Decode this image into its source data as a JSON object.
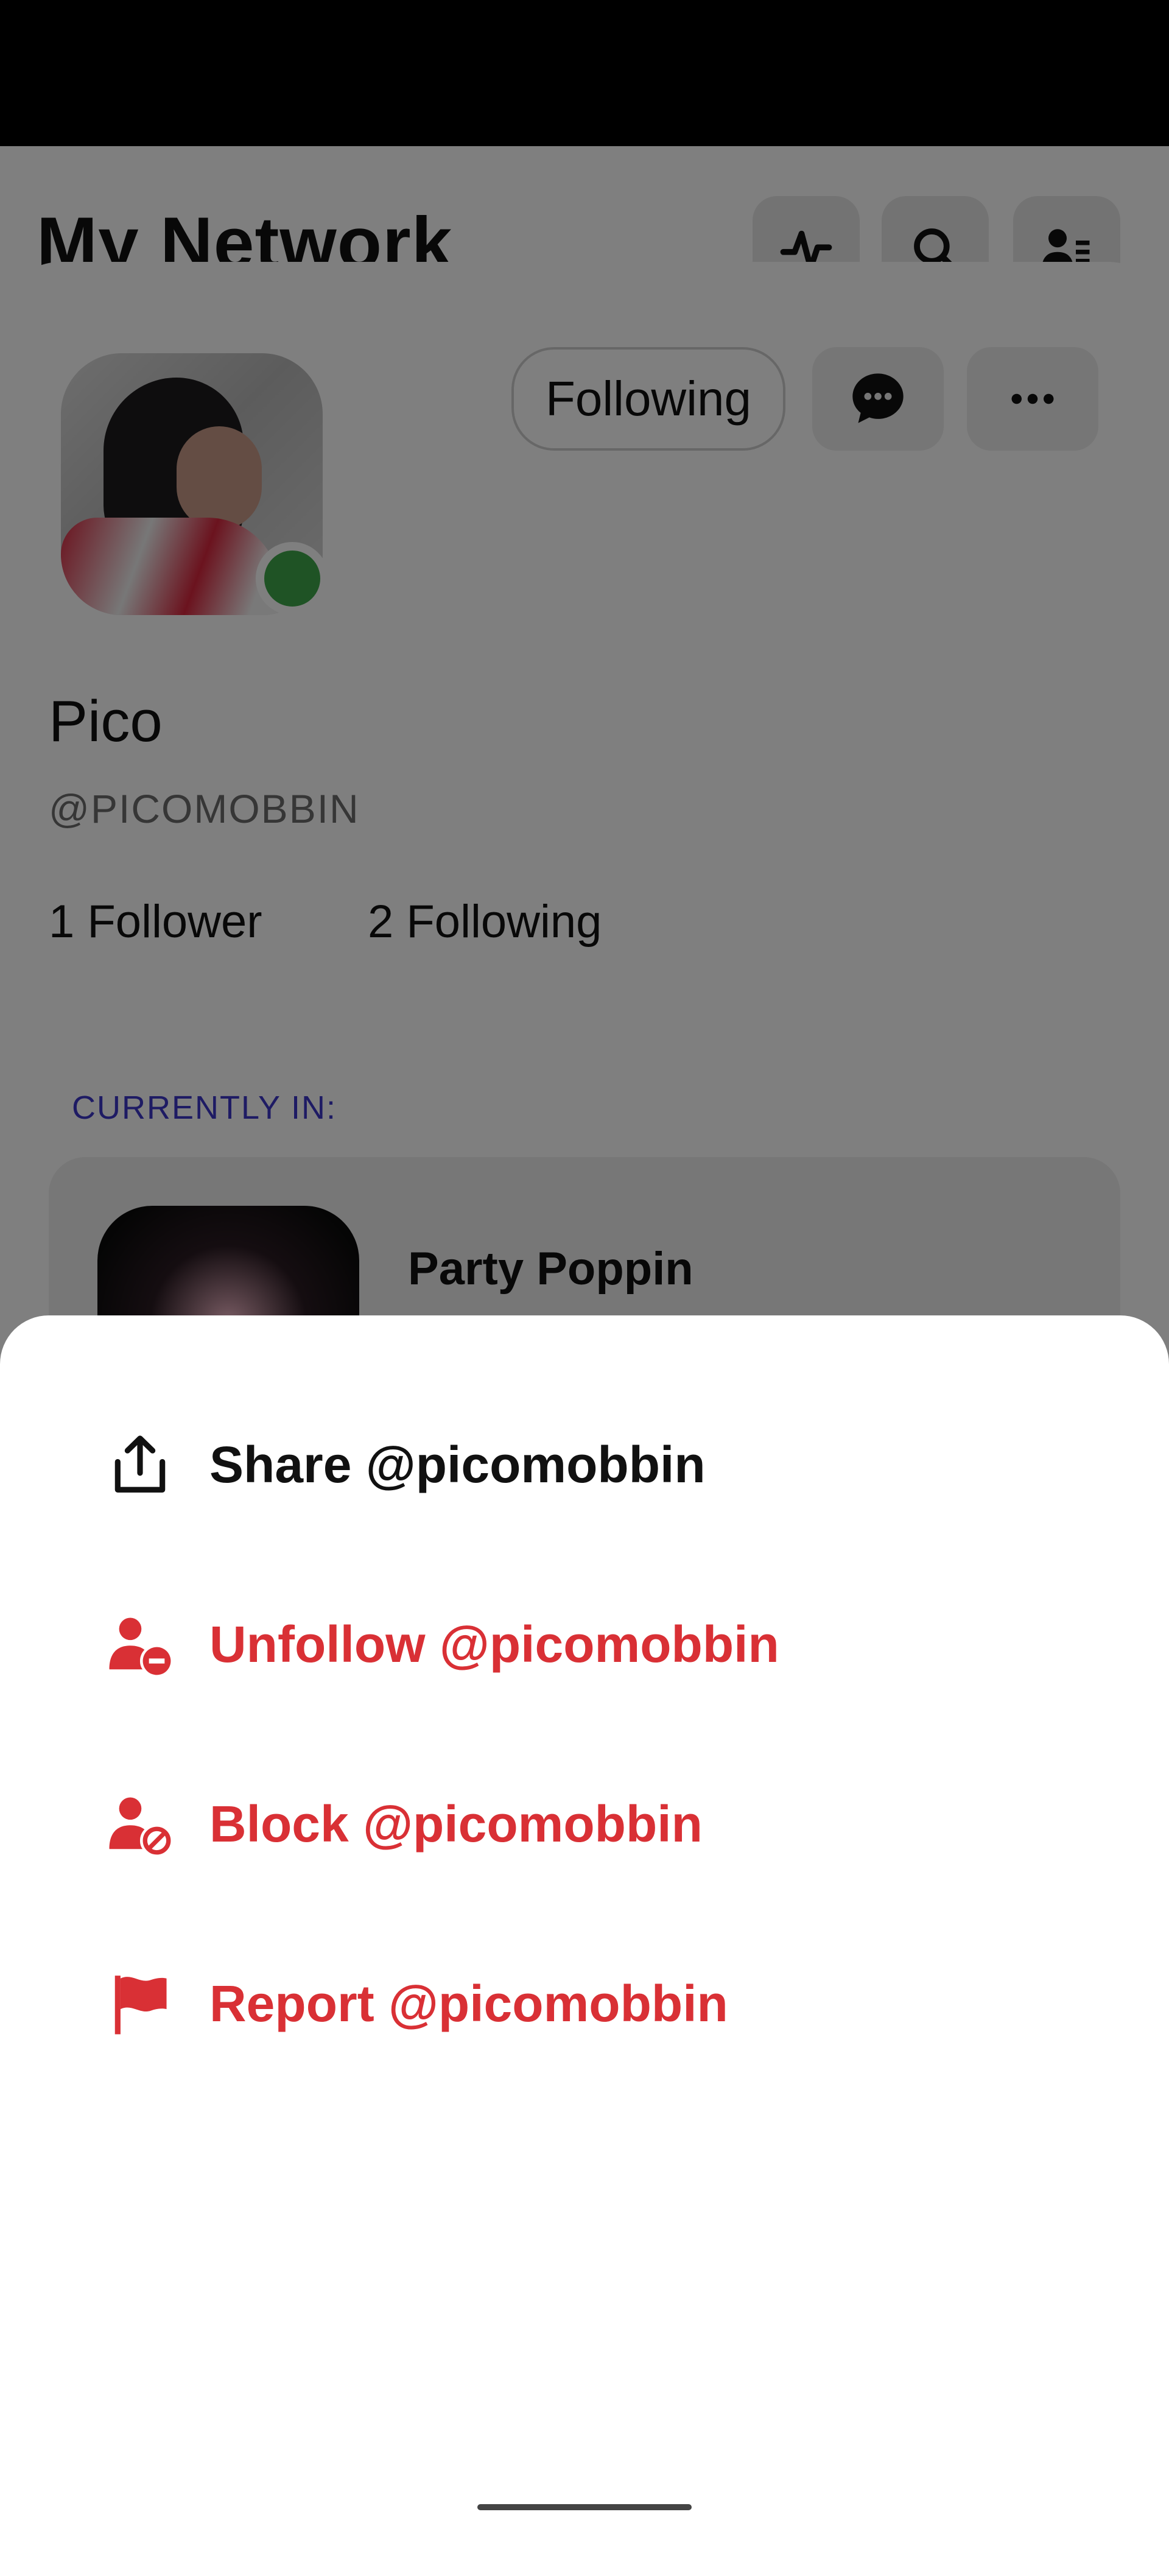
{
  "background": {
    "page_title": "My Network",
    "header_icons": [
      "activity-icon",
      "search-icon",
      "contacts-icon"
    ],
    "profile": {
      "following_button": "Following",
      "name": "Pico",
      "handle": "@PICOMOBBIN",
      "followers": "1 Follower",
      "following": "2 Following",
      "currently_in_label": "CURRENTLY IN:",
      "room_name": "Party Poppin"
    }
  },
  "sheet": {
    "items": [
      {
        "label": "Share @picomobbin",
        "icon": "share-icon",
        "color": "#111111"
      },
      {
        "label": "Unfollow @picomobbin",
        "icon": "unfollow-user-icon",
        "color": "#d93035"
      },
      {
        "label": "Block @picomobbin",
        "icon": "block-user-icon",
        "color": "#d93035"
      },
      {
        "label": "Report @picomobbin",
        "icon": "flag-icon",
        "color": "#d93035"
      }
    ]
  },
  "colors": {
    "accent_red": "#d93035",
    "online_green": "#3fa64a",
    "label_purple": "#3c36c8"
  }
}
